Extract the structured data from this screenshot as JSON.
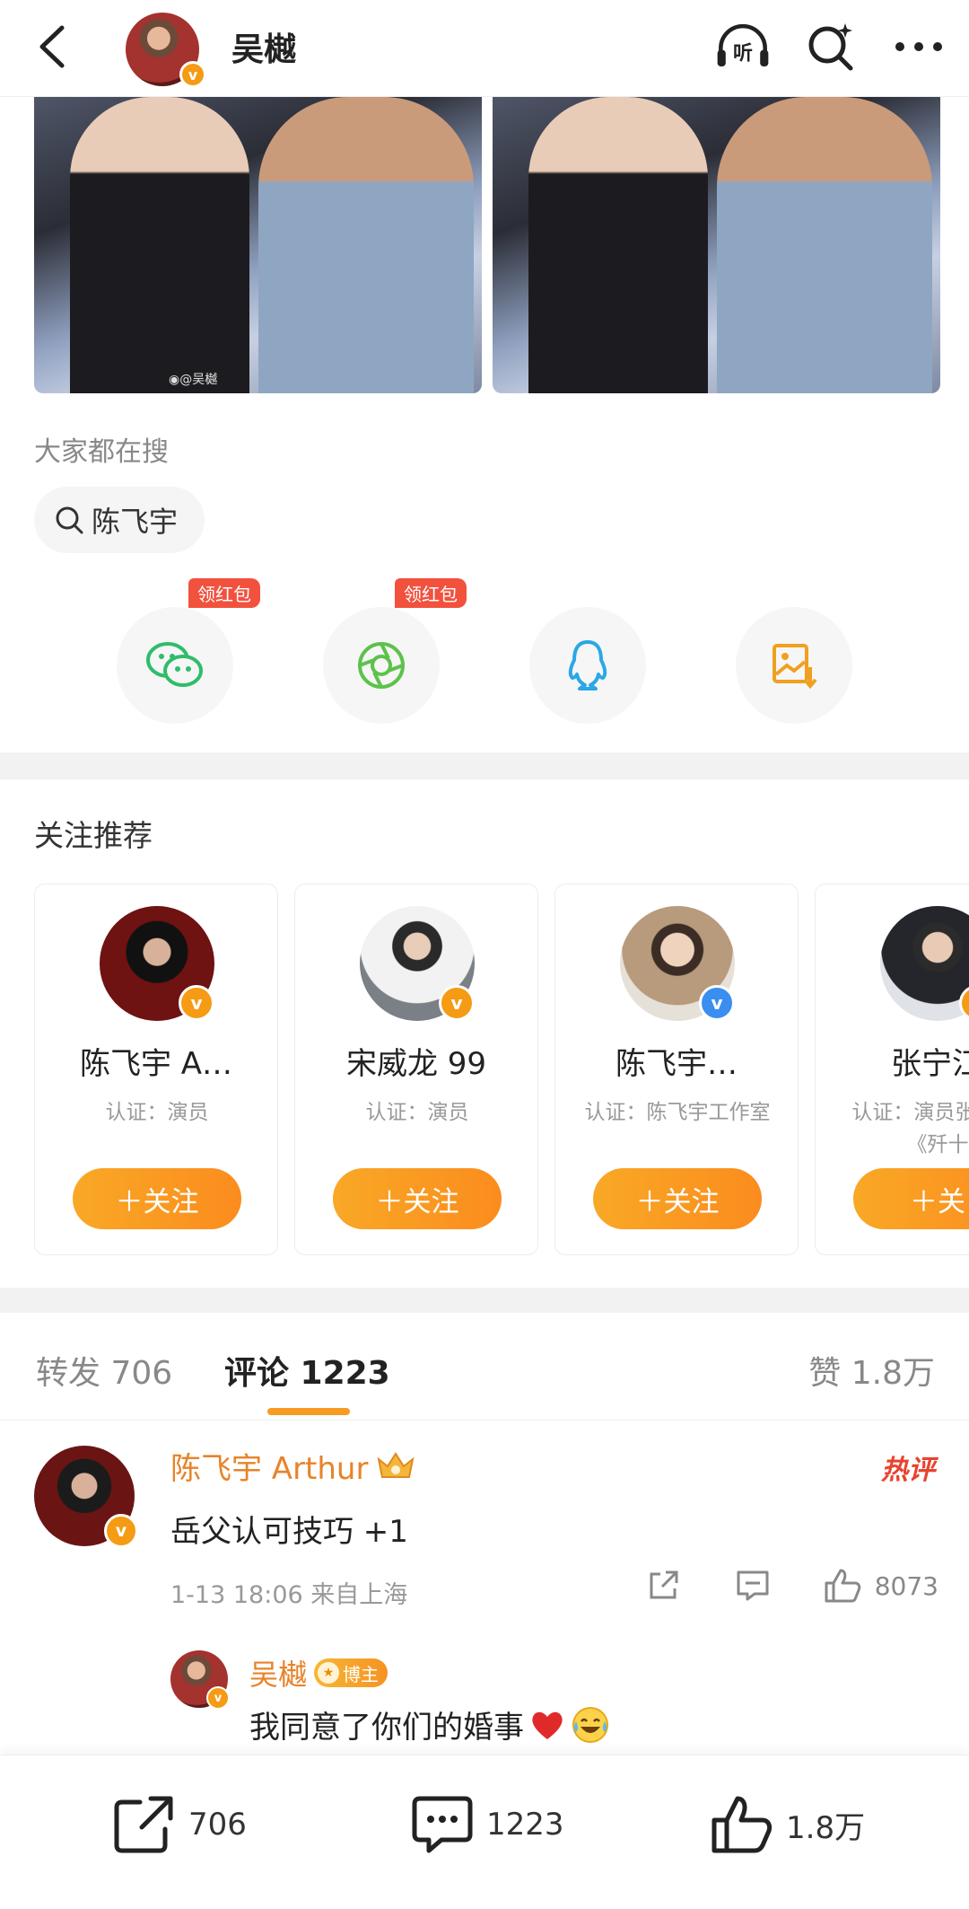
{
  "header": {
    "username": "吴樾",
    "listen_label": "听"
  },
  "photos": {
    "watermark": "◉@吴樾"
  },
  "search": {
    "section_label": "大家都在搜",
    "chip_text": "陈飞宇"
  },
  "share": {
    "wechat_tag": "领红包",
    "moments_tag": "领红包"
  },
  "recommend": {
    "title": "关注推荐",
    "cards": [
      {
        "name": "陈飞宇 A…",
        "cert": "认证：演员",
        "follow": "＋关注"
      },
      {
        "name": "宋威龙 99",
        "cert": "认证：演员",
        "follow": "＋关注"
      },
      {
        "name": "陈飞宇…",
        "cert": "认证：陈飞宇工作室",
        "follow": "＋关注"
      },
      {
        "name": "张宁江",
        "cert": "认证：演员张 参演《歼十",
        "follow": "＋关"
      }
    ]
  },
  "tabs": {
    "repost": "转发 706",
    "comments": "评论 1223",
    "likes": "赞 1.8万"
  },
  "comment": {
    "author": "陈飞宇 Arthur",
    "hot_label": "热评",
    "text": "岳父认可技巧 +1",
    "meta": "1-13 18:06  来自上海",
    "like_count": "8073",
    "reply": {
      "author": "吴樾",
      "badge": "博主",
      "text": "我同意了你们的婚事"
    }
  },
  "bottom": {
    "repost_count": "706",
    "comment_count": "1223",
    "like_count": "1.8万"
  },
  "colors": {
    "accent": "#f79b22",
    "author": "#e8832a",
    "hot": "#e6442f",
    "tag": "#f2513e"
  }
}
